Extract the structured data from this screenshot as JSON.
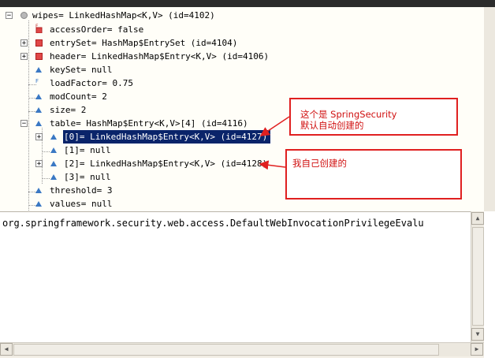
{
  "tree": {
    "root": {
      "label": "wipes= LinkedHashMap<K,V>  (id=4102)"
    },
    "access_order": {
      "label": "accessOrder= false"
    },
    "entry_set": {
      "label": "entrySet= HashMap$EntrySet  (id=4104)"
    },
    "header": {
      "label": "header= LinkedHashMap$Entry<K,V>  (id=4106)"
    },
    "key_set": {
      "label": "keySet= null"
    },
    "load_factor": {
      "label": "loadFactor= 0.75"
    },
    "mod_count": {
      "label": "modCount= 2"
    },
    "size": {
      "label": "size= 2"
    },
    "table": {
      "label": "table= HashMap$Entry<K,V>[4]  (id=4116)"
    },
    "table_0": {
      "label": "[0]= LinkedHashMap$Entry<K,V>  (id=4127)"
    },
    "table_1": {
      "label": "[1]= null"
    },
    "table_2": {
      "label": "[2]= LinkedHashMap$Entry<K,V>  (id=4128)"
    },
    "table_3": {
      "label": "[3]= null"
    },
    "threshold": {
      "label": "threshold= 3"
    },
    "values": {
      "label": "values= null"
    }
  },
  "detail": {
    "text": "org.springframework.security.web.access.DefaultWebInvocationPrivilegeEvalu"
  },
  "annotations": {
    "springsecurity_line1": "这个是 SpringSecurity",
    "springsecurity_line2": "默认自动创建的",
    "self_created": "我自己创建的"
  },
  "colors": {
    "selection": "#0a246a",
    "annotation_red": "#e02020",
    "field_icon_blue": "#3a78c4",
    "private_icon_red": "#e04848"
  }
}
